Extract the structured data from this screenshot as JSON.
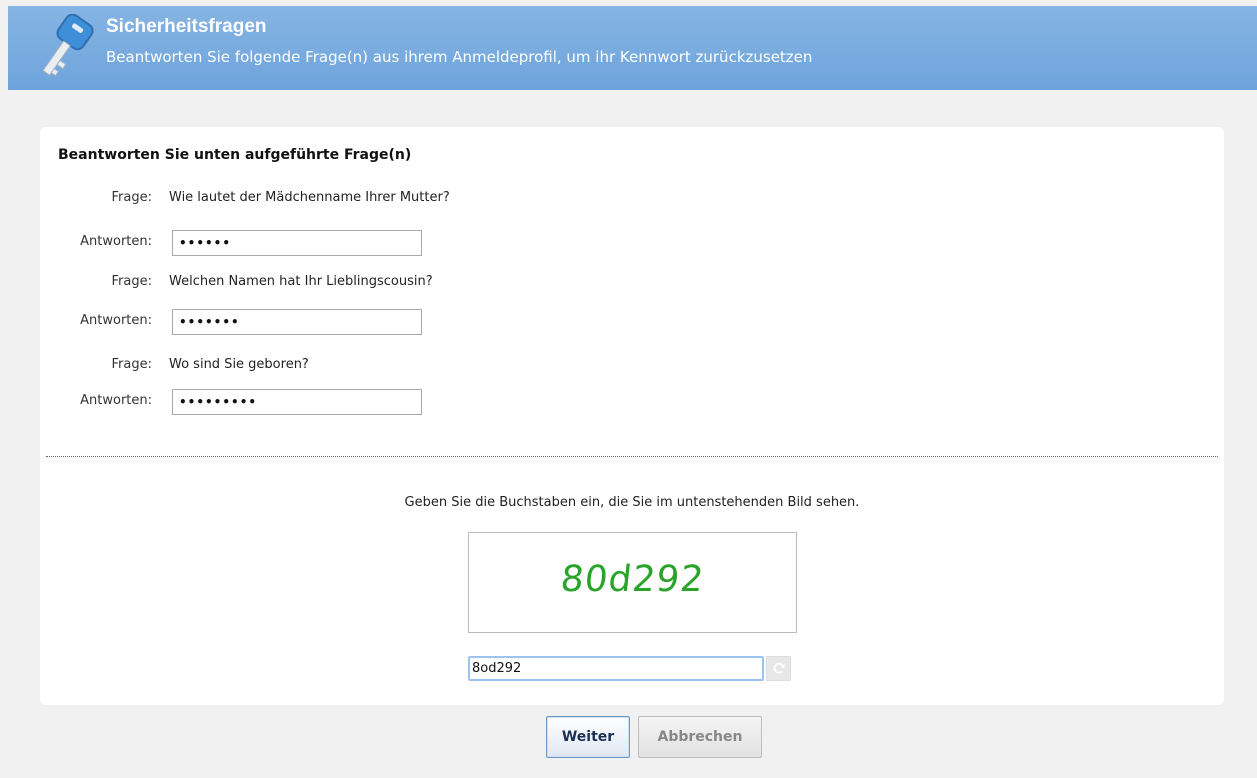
{
  "header": {
    "title": "Sicherheitsfragen",
    "subtitle": "Beantworten Sie folgende Frage(n) aus ihrem Anmeldeprofil, um ihr Kennwort zurückzusetzen"
  },
  "form": {
    "section_title": "Beantworten Sie unten aufgeführte Frage(n)",
    "question_label": "Frage:",
    "answer_label": "Antworten:",
    "questions": [
      {
        "question": "Wie lautet der Mädchenname Ihrer Mutter?",
        "answer_mask": "••••••"
      },
      {
        "question": "Welchen Namen hat Ihr Lieblingscousin?",
        "answer_mask": "•••••••"
      },
      {
        "question": "Wo sind Sie geboren?",
        "answer_mask": "•••••••••"
      }
    ]
  },
  "captcha": {
    "prompt": "Geben Sie die Buchstaben ein, die Sie im untenstehenden Bild sehen.",
    "image_text": "80d292",
    "input_value": "8od292"
  },
  "buttons": {
    "next": "Weiter",
    "cancel": "Abbrechen"
  },
  "colors": {
    "header_bg": "#78a9de",
    "captcha_text": "#2aa32a"
  }
}
